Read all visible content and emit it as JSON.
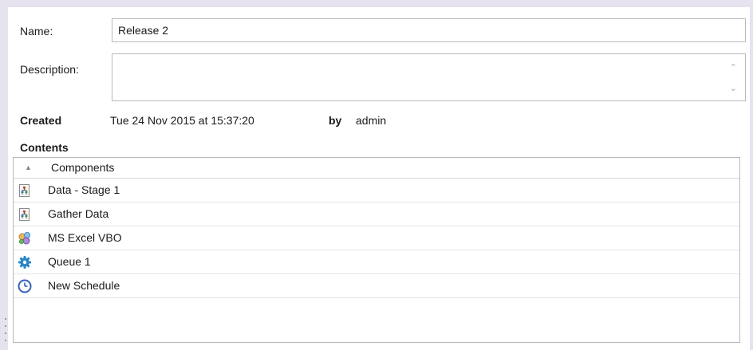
{
  "form": {
    "name_label": "Name:",
    "name_value": "Release 2",
    "description_label": "Description:",
    "description_value": "",
    "created_label": "Created",
    "created_value": "Tue 24 Nov 2015 at 15:37:20",
    "by_label": "by",
    "by_value": "admin",
    "contents_label": "Contents"
  },
  "contents": {
    "column_header": "Components",
    "items": [
      {
        "label": "Data - Stage 1",
        "icon": "process-icon"
      },
      {
        "label": "Gather Data",
        "icon": "process-icon"
      },
      {
        "label": "MS Excel VBO",
        "icon": "business-object-icon"
      },
      {
        "label": "Queue 1",
        "icon": "gear-icon"
      },
      {
        "label": "New Schedule",
        "icon": "clock-icon"
      }
    ]
  },
  "colors": {
    "background": "#e6e3ee",
    "panel": "#ffffff",
    "border": "#b9b9b9",
    "gear": "#2a86c8",
    "clock": "#3560b8"
  }
}
